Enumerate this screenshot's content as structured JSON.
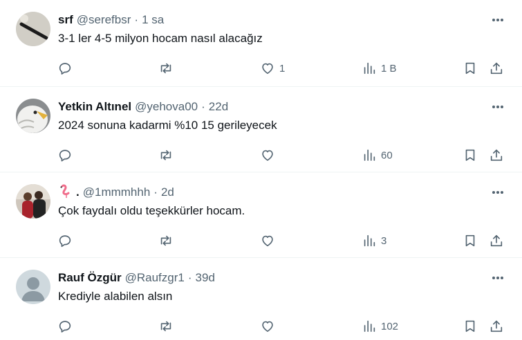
{
  "tweets": [
    {
      "name": "srf",
      "handle": "@serefbsr",
      "time": "1 sa",
      "text": "3-1 ler 4-5 milyon hocam nasıl alacağız",
      "likes": "1",
      "views": "1 B"
    },
    {
      "name": "Yetkin Altınel",
      "handle": "@yehova00",
      "time": "22d",
      "text": "2024 sonuna kadarmi %10 15 gerileyecek",
      "likes": "",
      "views": "60"
    },
    {
      "name": ".",
      "name_emoji": "flamingo",
      "handle": "@1mmmhhh",
      "time": "2d",
      "text": "Çok faydalı oldu teşekkürler hocam.",
      "likes": "",
      "views": "3"
    },
    {
      "name": "Rauf Özgür",
      "handle": "@Raufzgr1",
      "time": "39d",
      "text": "Krediyle alabilen alsın",
      "likes": "",
      "views": "102"
    }
  ],
  "separator": "·",
  "colors": {
    "text_primary": "#0f1419",
    "text_secondary": "#536471",
    "divider": "#eff3f4"
  }
}
